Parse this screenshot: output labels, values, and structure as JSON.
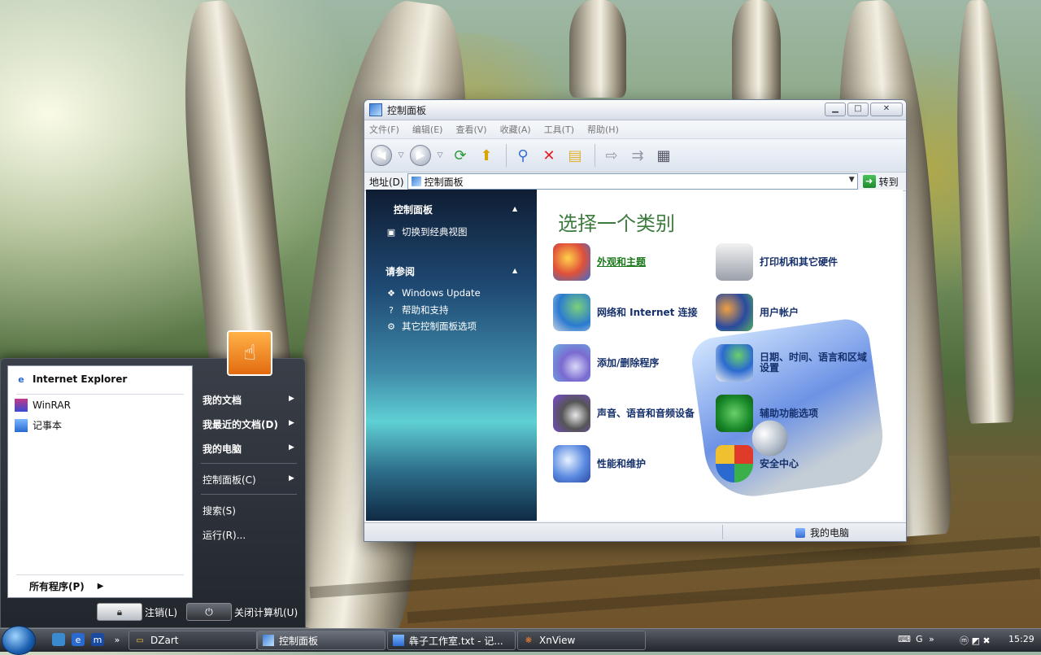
{
  "window": {
    "title": "控制面板",
    "menu": [
      "文件(F)",
      "编辑(E)",
      "查看(V)",
      "收藏(A)",
      "工具(T)",
      "帮助(H)"
    ],
    "address_label": "地址(D)",
    "address_value": "控制面板",
    "go_label": "转到",
    "left_pane": {
      "section1_title": "控制面板",
      "switch_view": "切换到经典视图",
      "section2_title": "请参阅",
      "links": [
        "Windows Update",
        "帮助和支持",
        "其它控制面板选项"
      ]
    },
    "main": {
      "heading": "选择一个类别",
      "categories": [
        "外观和主题",
        "打印机和其它硬件",
        "网络和 Internet 连接",
        "用户帐户",
        "添加/删除程序",
        "日期、时间、语言和区域设置",
        "声音、语音和音频设备",
        "辅助功能选项",
        "性能和维护",
        "安全中心"
      ]
    },
    "status": "我的电脑"
  },
  "start_menu": {
    "pinned": [
      "Internet Explorer"
    ],
    "recent": [
      "WinRAR",
      "记事本"
    ],
    "all_programs": "所有程序(P)",
    "right": [
      "我的文档",
      "我最近的文档(D)",
      "我的电脑",
      "控制面板(C)",
      "搜索(S)",
      "运行(R)..."
    ],
    "logoff": "注销(L)",
    "shutdown": "关闭计算机(U)"
  },
  "taskbar": {
    "tasks": [
      "DZart",
      "控制面板",
      "犇子工作室.txt - 记...",
      "XnView"
    ],
    "tray_items": [
      "G",
      "»"
    ],
    "clock": "15:29"
  }
}
